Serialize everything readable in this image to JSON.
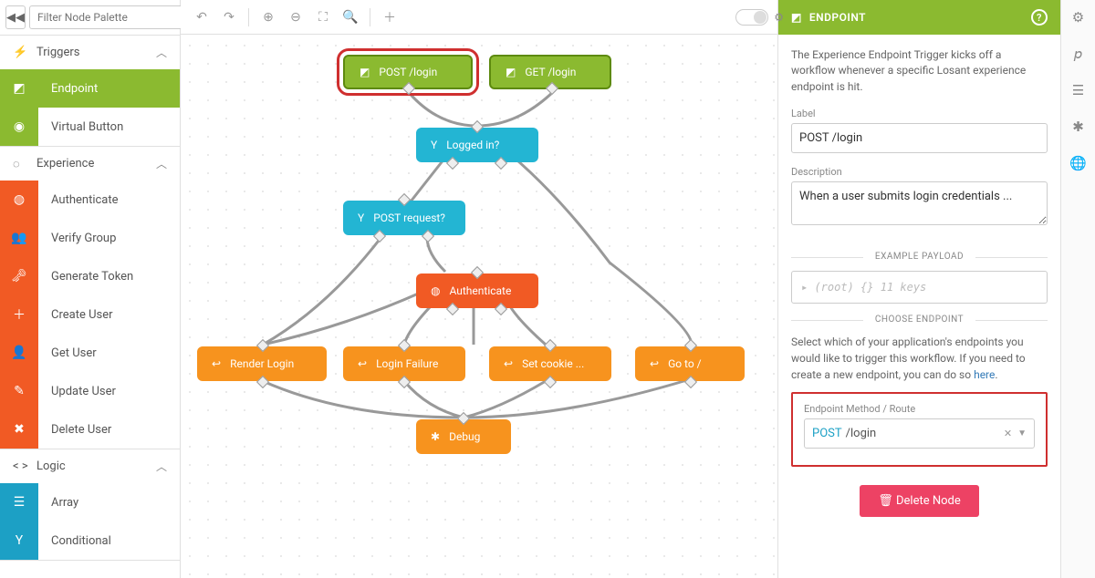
{
  "palette": {
    "filter_placeholder": "Filter Node Palette",
    "sections": {
      "triggers": {
        "title": "Triggers",
        "items": [
          {
            "icon": "◩",
            "label": "Endpoint",
            "active": true
          },
          {
            "icon": "◉",
            "label": "Virtual Button"
          }
        ]
      },
      "experience": {
        "title": "Experience",
        "icon": "◌",
        "items": [
          {
            "icon": "◍",
            "label": "Authenticate"
          },
          {
            "icon": "👥",
            "label": "Verify Group"
          },
          {
            "icon": "🔑",
            "label": "Generate Token"
          },
          {
            "icon": "➕",
            "label": "Create User"
          },
          {
            "icon": "👤",
            "label": "Get User"
          },
          {
            "icon": "✎",
            "label": "Update User"
          },
          {
            "icon": "✖",
            "label": "Delete User"
          }
        ]
      },
      "logic": {
        "title": "Logic",
        "icon": "< >",
        "items": [
          {
            "icon": "☰",
            "label": "Array"
          },
          {
            "icon": "Y",
            "label": "Conditional"
          }
        ]
      }
    }
  },
  "canvas": {
    "nodes": {
      "post_login": {
        "label": "POST /login"
      },
      "get_login": {
        "label": "GET /login"
      },
      "logged_in": {
        "label": "Logged in?"
      },
      "post_request": {
        "label": "POST request?"
      },
      "authenticate": {
        "label": "Authenticate"
      },
      "render_login": {
        "label": "Render Login"
      },
      "login_failure": {
        "label": "Login Failure"
      },
      "set_cookie": {
        "label": "Set cookie ..."
      },
      "go_to": {
        "label": "Go to /"
      },
      "debug": {
        "label": "Debug"
      }
    }
  },
  "right": {
    "title": "ENDPOINT",
    "intro": "The Experience Endpoint Trigger kicks off a workflow whenever a specific Losant experience endpoint is hit.",
    "label_label": "Label",
    "label_value": "POST /login",
    "desc_label": "Description",
    "desc_value": "When a user submits login credentials ...",
    "example_payload": "EXAMPLE PAYLOAD",
    "payload_preview": "▸  (root)  {}  11 keys",
    "choose_endpoint": "CHOOSE ENDPOINT",
    "choose_text": "Select which of your application's endpoints you would like to trigger this workflow. If you need to create a new endpoint, you can do so ",
    "choose_link": "here",
    "endpoint_label": "Endpoint Method / Route",
    "endpoint_method": "POST",
    "endpoint_route": "/login",
    "delete": "Delete Node"
  }
}
